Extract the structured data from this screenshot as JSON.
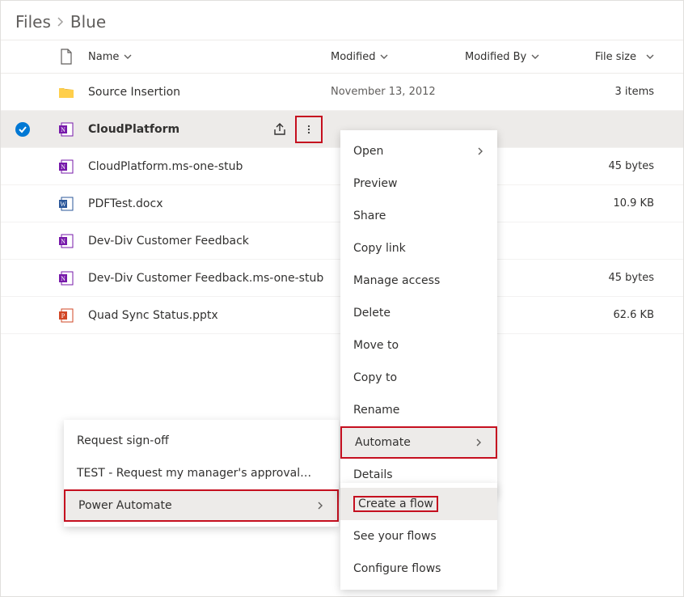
{
  "breadcrumb": {
    "root": "Files",
    "current": "Blue"
  },
  "columns": {
    "name": "Name",
    "modified": "Modified",
    "modifiedBy": "Modified By",
    "size": "File size"
  },
  "rows": [
    {
      "kind": "folder",
      "name": "Source Insertion",
      "modified": "November 13, 2012",
      "size": "3 items",
      "selected": false
    },
    {
      "kind": "onenote",
      "name": "CloudPlatform",
      "modified": "",
      "size": "",
      "selected": true
    },
    {
      "kind": "onenote",
      "name": "CloudPlatform.ms-one-stub",
      "modified": "",
      "size": "45 bytes",
      "selected": false
    },
    {
      "kind": "word",
      "name": "PDFTest.docx",
      "modified": "",
      "size": "10.9 KB",
      "selected": false
    },
    {
      "kind": "onenote",
      "name": "Dev-Div Customer Feedback",
      "modified": "",
      "size": "",
      "selected": false
    },
    {
      "kind": "onenote",
      "name": "Dev-Div Customer Feedback.ms-one-stub",
      "modified": "",
      "size": "45 bytes",
      "selected": false
    },
    {
      "kind": "ppt",
      "name": "Quad Sync Status.pptx",
      "modified": "",
      "size": "62.6 KB",
      "selected": false
    }
  ],
  "contextMenu": {
    "open": "Open",
    "preview": "Preview",
    "share": "Share",
    "copylink": "Copy link",
    "manage": "Manage access",
    "delete": "Delete",
    "moveto": "Move to",
    "copyto": "Copy to",
    "rename": "Rename",
    "automate": "Automate",
    "details": "Details"
  },
  "automateSub": {
    "requestSignoff": "Request sign-off",
    "testApproval": "TEST - Request my manager's approval…",
    "powerAutomate": "Power Automate"
  },
  "powerAutomateSub": {
    "create": "Create a flow",
    "see": "See your flows",
    "configure": "Configure flows"
  }
}
